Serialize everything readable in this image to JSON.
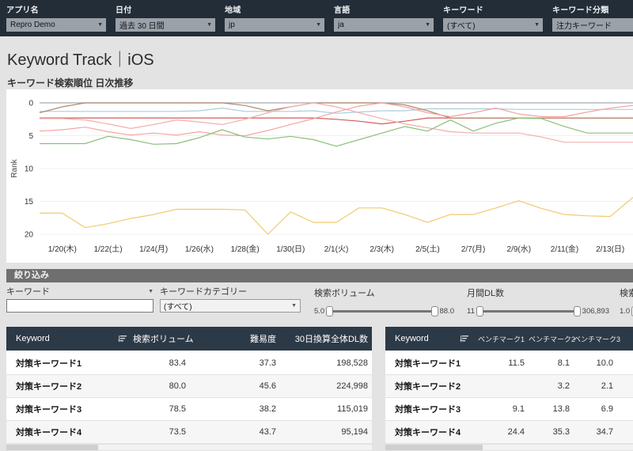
{
  "colors": {
    "topbar_bg": "#232d38",
    "dropdown_bg": "#9ba1a8",
    "page_bg": "#e3e3e3",
    "section_bar_bg": "#6f6f6f",
    "table_header_bg": "#2c3947",
    "row_alt_bg": "#f6f6f6"
  },
  "top_filters": [
    {
      "label": "アプリ名",
      "value": "Repro Demo"
    },
    {
      "label": "日付",
      "value": "過去 30 日間"
    },
    {
      "label": "地域",
      "value": "jp"
    },
    {
      "label": "言語",
      "value": "ja"
    },
    {
      "label": "キーワード",
      "value": "(すべて)"
    },
    {
      "label": "キーワード分類",
      "value": "注力キーワード"
    }
  ],
  "page_title": "Keyword Track｜iOS",
  "chart_data": {
    "type": "line",
    "title": "キーワード検索順位 日次推移",
    "ylabel": "Rank",
    "y_ticks": [
      0,
      5,
      10,
      15,
      20
    ],
    "y_inverted": true,
    "ylim": [
      0,
      21
    ],
    "x_tick_labels": [
      "1/20(木)",
      "1/22(土)",
      "1/24(月)",
      "1/26(水)",
      "1/28(金)",
      "1/30(日)",
      "2/1(火)",
      "2/3(木)",
      "2/5(土)",
      "2/7(月)",
      "2/9(水)",
      "2/11(金)",
      "2/13(日)"
    ],
    "points_per_series": 27,
    "label_indices": [
      1,
      3,
      5,
      7,
      9,
      11,
      13,
      15,
      17,
      19,
      21,
      23,
      25
    ],
    "legend": "none",
    "grid": "off",
    "series": [
      {
        "name": "rank-line-gray",
        "color": "#a9a9b0",
        "values": [
          0,
          0,
          0,
          0,
          0,
          0,
          0,
          0,
          0,
          0,
          0,
          0,
          0,
          0,
          0,
          0,
          0,
          0,
          0,
          0,
          0,
          0,
          0,
          0,
          0,
          0,
          0
        ]
      },
      {
        "name": "rank-line-cyan",
        "color": "#a8cfdd",
        "values": [
          1.3,
          1.3,
          1.3,
          1.3,
          1.3,
          1.3,
          1.3,
          1.2,
          0.8,
          1.3,
          1.3,
          1.3,
          1.2,
          1.6,
          1.4,
          1.2,
          1.2,
          0.9,
          0.9,
          0.9,
          0.9,
          1.0,
          1.0,
          1.0,
          1.0,
          1.0,
          1.0
        ]
      },
      {
        "name": "rank-line-red",
        "color": "#d45b5b",
        "values": [
          2.3,
          2.3,
          2.3,
          2.3,
          2.3,
          2.3,
          2.3,
          2.3,
          2.3,
          2.3,
          2.3,
          2.3,
          2.3,
          2.5,
          2.8,
          3.2,
          2.8,
          2.3,
          2.3,
          2.3,
          2.3,
          2.3,
          2.3,
          2.3,
          2.3,
          2.3,
          2.3
        ]
      },
      {
        "name": "rank-line-brown",
        "color": "#b08a6e",
        "values": [
          1.5,
          0.6,
          0,
          0,
          0,
          0,
          0,
          0,
          0,
          0.4,
          1.2,
          0.6,
          0,
          0,
          0,
          0,
          0.3,
          1.2,
          2.3,
          2.3,
          2.3,
          2.3,
          2.3,
          2.3,
          2.3,
          2.3,
          2.3
        ]
      },
      {
        "name": "rank-line-pink",
        "color": "#f2b0ad",
        "values": [
          2.4,
          2.4,
          2.6,
          3.2,
          3.9,
          3.3,
          2.6,
          2.9,
          3.3,
          2.5,
          1.5,
          0.6,
          0,
          0.6,
          1.5,
          2.4,
          3.2,
          3.8,
          4.4,
          4.6,
          4.6,
          4.6,
          5.2,
          6.0,
          6.0,
          6.0,
          6.0
        ]
      },
      {
        "name": "rank-line-salmon",
        "color": "#f5a3a0",
        "values": [
          4.3,
          4.1,
          3.7,
          4.4,
          4.9,
          4.6,
          4.9,
          4.4,
          4.9,
          5.0,
          4.2,
          3.3,
          2.4,
          1.4,
          0.5,
          0,
          0.6,
          1.5,
          2.1,
          1.5,
          0.8,
          1.7,
          2.1,
          2.1,
          1.4,
          0.8,
          0.4
        ]
      },
      {
        "name": "rank-line-green",
        "color": "#8cbf7c",
        "values": [
          6.2,
          6.2,
          6.2,
          5.1,
          5.6,
          6.3,
          6.2,
          5.3,
          4.1,
          5.2,
          5.5,
          5.1,
          5.6,
          6.6,
          5.6,
          4.6,
          3.6,
          4.3,
          2.6,
          4.3,
          3.1,
          2.3,
          2.4,
          3.6,
          4.6,
          4.6,
          4.6
        ]
      },
      {
        "name": "rank-line-yellow",
        "color": "#f0ca6e",
        "values": [
          16.8,
          16.8,
          19.0,
          18.4,
          17.6,
          17.0,
          16.2,
          16.2,
          16.2,
          16.3,
          20.0,
          16.6,
          18.2,
          18.2,
          16.0,
          16.0,
          17.0,
          18.2,
          17.0,
          17.0,
          16.0,
          14.9,
          16.1,
          17.0,
          17.2,
          17.3,
          14.4
        ]
      }
    ]
  },
  "filter_section": {
    "title": "絞り込み",
    "keyword": {
      "label": "キーワード",
      "value": "",
      "placeholder": ""
    },
    "category": {
      "label": "キーワードカテゴリー",
      "value": "(すべて)"
    },
    "sliders": [
      {
        "label": "検索ボリューム",
        "min": "5.0",
        "max": "88.0"
      },
      {
        "label": "月間DL数",
        "min": "11",
        "max": "306,893"
      },
      {
        "label": "検索",
        "min": "1.0",
        "max": ""
      }
    ]
  },
  "left_table": {
    "columns": [
      "Keyword",
      "検索ボリューム",
      "難易度",
      "30日換算全体DL数"
    ],
    "rows": [
      {
        "keyword": "対策キーワード1",
        "values": [
          "83.4",
          "37.3",
          "198,528"
        ]
      },
      {
        "keyword": "対策キーワード2",
        "values": [
          "80.0",
          "45.6",
          "224,998"
        ]
      },
      {
        "keyword": "対策キーワード3",
        "values": [
          "78.5",
          "38.2",
          "115,019"
        ]
      },
      {
        "keyword": "対策キーワード4",
        "values": [
          "73.5",
          "43.7",
          "95,194"
        ]
      }
    ]
  },
  "right_table": {
    "columns": [
      "Keyword",
      "ベンチマーク1",
      "ベンチマーク2",
      "ベンチマーク3"
    ],
    "rows": [
      {
        "keyword": "対策キーワード1",
        "values": [
          "11.5",
          "8.1",
          "10.0"
        ]
      },
      {
        "keyword": "対策キーワード2",
        "values": [
          "",
          "3.2",
          "2.1"
        ]
      },
      {
        "keyword": "対策キーワード3",
        "values": [
          "9.1",
          "13.8",
          "6.9"
        ]
      },
      {
        "keyword": "対策キーワード4",
        "values": [
          "24.4",
          "35.3",
          "34.7"
        ]
      }
    ]
  }
}
